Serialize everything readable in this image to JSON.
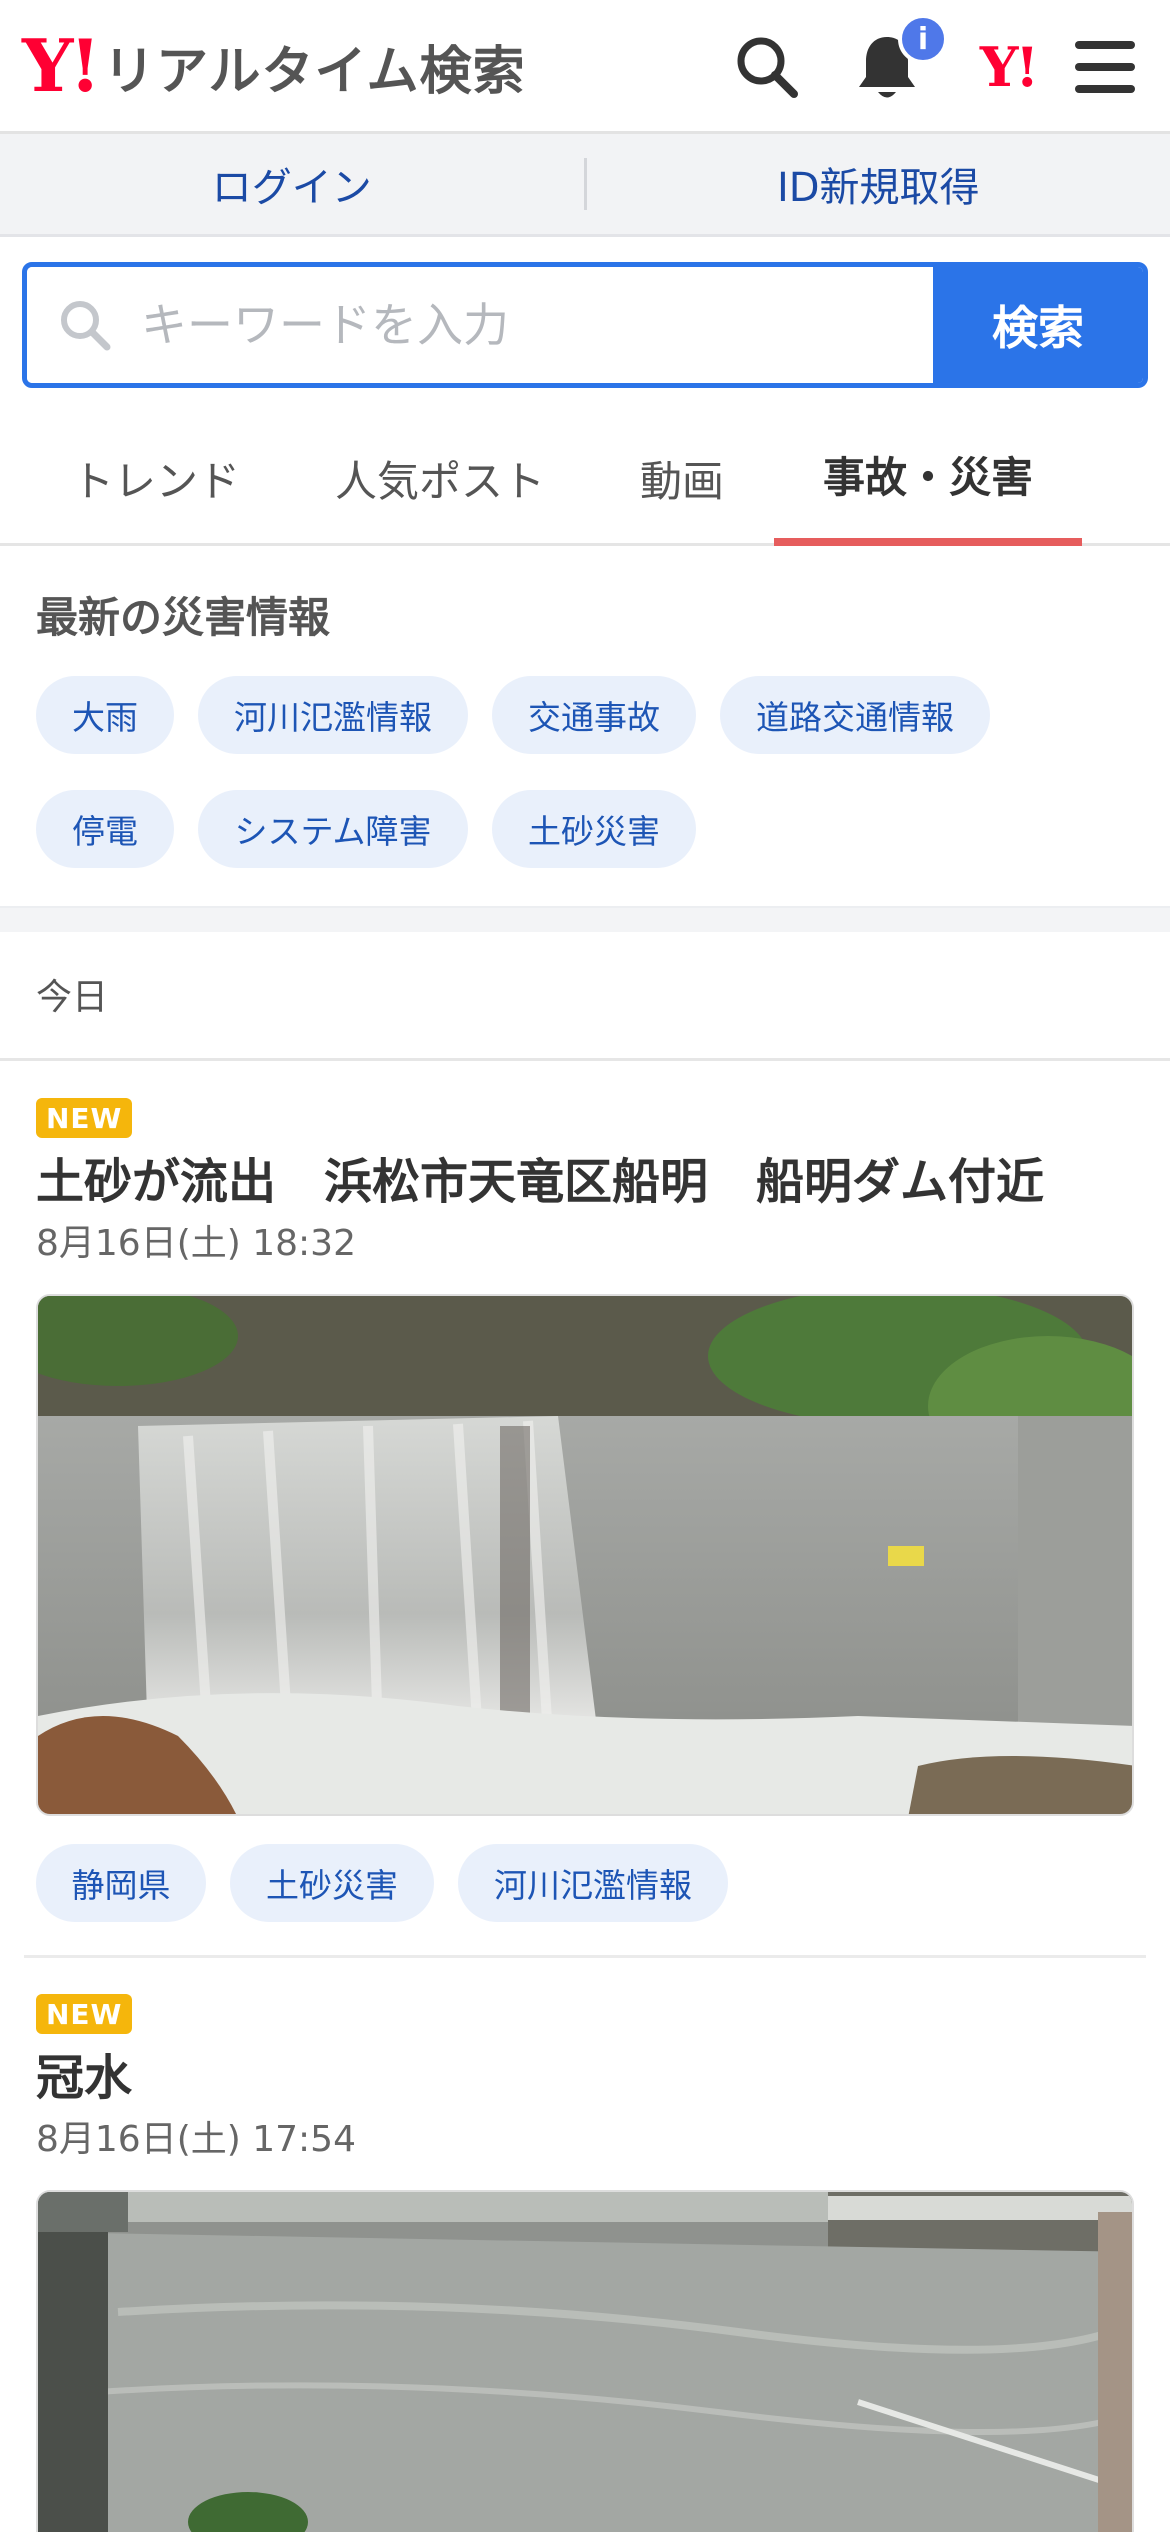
{
  "header": {
    "logo_mark": "Y!",
    "logo_text": "リアルタイム検索",
    "notification_badge": "i",
    "yahoo_mark": "Y!",
    "accent_color": "#ff0033"
  },
  "login_bar": {
    "login_label": "ログイン",
    "register_label": "ID新規取得"
  },
  "search": {
    "placeholder": "キーワードを入力",
    "button_label": "検索"
  },
  "tabs": [
    {
      "label": "トレンド"
    },
    {
      "label": "人気ポスト"
    },
    {
      "label": "動画"
    },
    {
      "label": "事故・災害",
      "active": true
    }
  ],
  "disaster_info": {
    "title": "最新の災害情報",
    "chips": [
      "大雨",
      "河川氾濫情報",
      "交通事故",
      "道路交通情報",
      "停電",
      "システム障害",
      "土砂災害"
    ]
  },
  "feed": {
    "day_label": "今日",
    "posts": [
      {
        "badge": "NEW",
        "title": "土砂が流出　浜松市天竜区船明　船明ダム付近",
        "time": "8月16日(土) 18:32",
        "tags": [
          "静岡県",
          "土砂災害",
          "河川氾濫情報"
        ]
      },
      {
        "badge": "NEW",
        "title": "冠水",
        "time": "8月16日(土) 17:54"
      }
    ]
  }
}
